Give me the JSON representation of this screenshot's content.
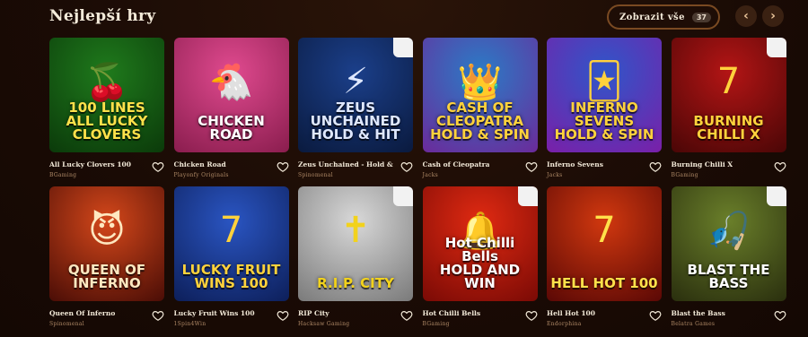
{
  "header": {
    "title": "Nejlepší hry",
    "show_all_label": "Zobrazit vše",
    "show_all_count": "37"
  },
  "icons": {
    "prev": "chevron-left-icon",
    "next": "chevron-right-icon",
    "favorite": "heart-icon"
  },
  "games": [
    {
      "name": "All Lucky Clovers 100",
      "provider": "BGaming",
      "thumb_text": "100 LINES\nALL LUCKY CLOVERS",
      "glyph": "🍒",
      "bg": "#1f7a1c",
      "bg2": "#0b3a0a",
      "text_color": "#ffe14a",
      "branded": false
    },
    {
      "name": "Chicken Road",
      "provider": "Playonfy Originals",
      "thumb_text": "CHICKEN ROAD",
      "glyph": "🐔",
      "bg": "#e04a8f",
      "bg2": "#8a1d4e",
      "text_color": "#ffffff",
      "branded": false
    },
    {
      "name": "Zeus Unchained - Hold & Hit",
      "provider": "Spinomenal",
      "thumb_text": "ZEUS UNCHAINED\nHOLD & HIT",
      "glyph": "⚡",
      "bg": "#1b3f8a",
      "bg2": "#0a1a3e",
      "text_color": "#dfe8ff",
      "branded": true
    },
    {
      "name": "Cash of Cleopatra",
      "provider": "Jacks",
      "thumb_text": "CASH OF CLEOPATRA\nHOLD & SPIN",
      "glyph": "👑",
      "bg": "#2b7bc6",
      "bg2": "#6b2a9a",
      "text_color": "#ffd23c",
      "branded": false
    },
    {
      "name": "Inferno Sevens",
      "provider": "Jacks",
      "thumb_text": "INFERNO SEVENS\nHOLD & SPIN",
      "glyph": "🃏",
      "bg": "#2f56c9",
      "bg2": "#7a1fa8",
      "text_color": "#ffd23c",
      "branded": false
    },
    {
      "name": "Burning Chilli X",
      "provider": "BGaming",
      "thumb_text": "BURNING CHILLI X",
      "glyph": "7",
      "bg": "#b31515",
      "bg2": "#4a0606",
      "text_color": "#ffd23c",
      "branded": true
    },
    {
      "name": "Queen Of Inferno",
      "provider": "Spinomenal",
      "thumb_text": "QUEEN OF INFERNO",
      "glyph": "😈",
      "bg": "#d4471a",
      "bg2": "#4a0d06",
      "text_color": "#ffe8c0",
      "branded": false
    },
    {
      "name": "Lucky Fruit Wins 100",
      "provider": "1Spin4Win",
      "thumb_text": "LUCKY FRUIT WINS 100",
      "glyph": "7",
      "bg": "#2a55c2",
      "bg2": "#0d1f5a",
      "text_color": "#ffd23c",
      "branded": false
    },
    {
      "name": "RIP City",
      "provider": "Hacksaw Gaming",
      "thumb_text": "R.I.P. CITY",
      "glyph": "✝",
      "bg": "#d8d8d8",
      "bg2": "#7a7a7a",
      "text_color": "#f2d21c",
      "branded": true
    },
    {
      "name": "Hot Chilli Bells",
      "provider": "BGaming",
      "thumb_text": "Hot Chilli Bells\nHOLD AND WIN",
      "glyph": "🔔",
      "bg": "#e02a12",
      "bg2": "#7a0a05",
      "text_color": "#ffffff",
      "branded": true
    },
    {
      "name": "Hell Hot 100",
      "provider": "Endorphina",
      "thumb_text": "HELL HOT 100",
      "glyph": "7",
      "bg": "#d1380f",
      "bg2": "#5a0805",
      "text_color": "#ffe14a",
      "branded": false
    },
    {
      "name": "Blast the Bass",
      "provider": "Belatra Games",
      "thumb_text": "BLAST THE BASS",
      "glyph": "🎣",
      "bg": "#6a7f2a",
      "bg2": "#2a2f0e",
      "text_color": "#ffffff",
      "branded": true
    }
  ]
}
